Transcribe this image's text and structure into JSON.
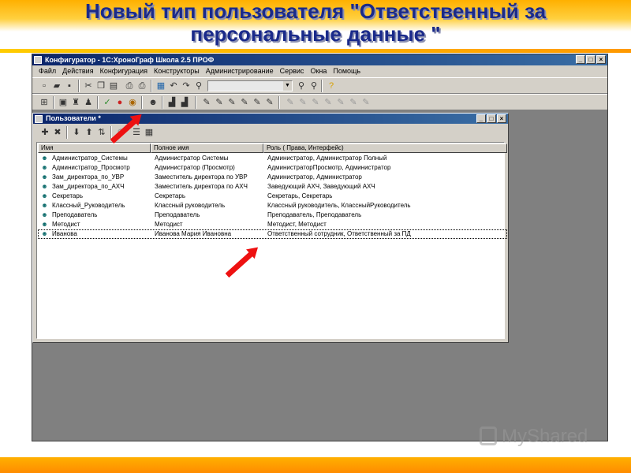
{
  "slide": {
    "title_line1": "Новый тип пользователя \"Ответственный за",
    "title_line2": "персональные данные \"",
    "watermark": "MyShared"
  },
  "app": {
    "title": "Конфигуратор - 1С:ХроноГраф Школа 2.5 ПРОФ",
    "menu": [
      "Файл",
      "Действия",
      "Конфигурация",
      "Конструкторы",
      "Администрирование",
      "Сервис",
      "Окна",
      "Помощь"
    ]
  },
  "child_window": {
    "title": "Пользователи *",
    "columns": [
      "Имя",
      "Полное имя",
      "Роль ( Права, Интерфейс)"
    ],
    "rows": [
      {
        "name": "Администратор_Системы",
        "full_name": "Администратор Системы",
        "role": "Администратор, Администратор Полный"
      },
      {
        "name": "Администратор_Просмотр",
        "full_name": "Администратор (Просмотр)",
        "role": "АдминистраторПросмотр, Администратор"
      },
      {
        "name": "Зам_директора_по_УВР",
        "full_name": "Заместитель директора по УВР",
        "role": "Администратор, Администратор"
      },
      {
        "name": "Зам_директора_по_АХЧ",
        "full_name": "Заместитель директора по АХЧ",
        "role": "Заведующий АХЧ, Заведующий АХЧ"
      },
      {
        "name": "Секретарь",
        "full_name": "Секретарь",
        "role": "Секретарь, Секретарь"
      },
      {
        "name": "Классный_Руководитель",
        "full_name": "Классный руководитель",
        "role": "Классный руководитель, КлассныйРуководитель"
      },
      {
        "name": "Преподаватель",
        "full_name": "Преподаватель",
        "role": "Преподаватель, Преподаватель"
      },
      {
        "name": "Методист",
        "full_name": "Методист",
        "role": "Методист, Методист"
      },
      {
        "name": "Иванова",
        "full_name": "Иванова Мария Ивановна",
        "role": "Ответственный сотрудник, Ответственный за ПД"
      }
    ]
  },
  "colors": {
    "accent": "#1a2a8a",
    "arrow": "#ee1111",
    "window_face": "#d4d0c8",
    "titlebar": "#0a246a"
  }
}
